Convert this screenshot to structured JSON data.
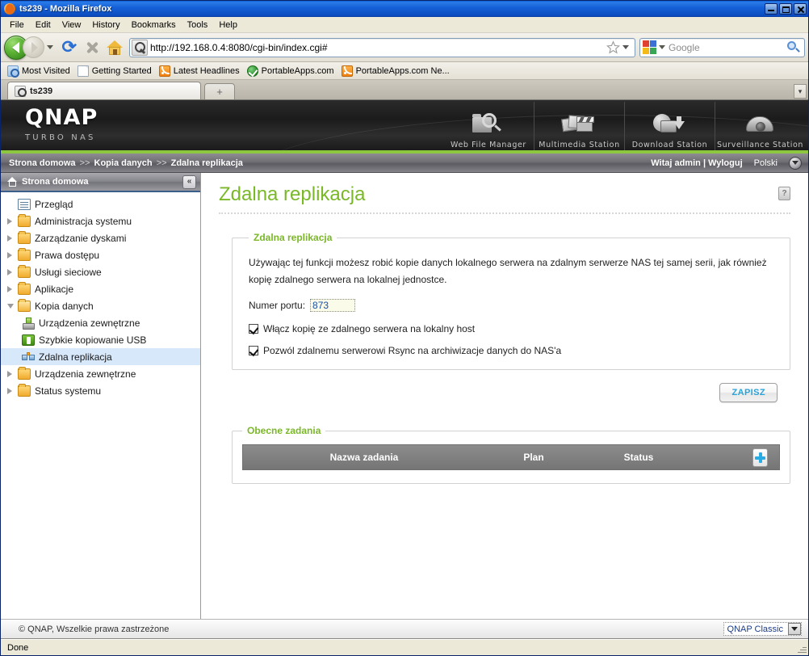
{
  "window": {
    "title": "ts239 - Mozilla Firefox",
    "favicon_icon": "firefox-icon",
    "minimize_label": "_",
    "maximize_label": "□",
    "close_label": "×"
  },
  "menubar": {
    "items": [
      {
        "label": "File"
      },
      {
        "label": "Edit"
      },
      {
        "label": "View"
      },
      {
        "label": "History"
      },
      {
        "label": "Bookmarks"
      },
      {
        "label": "Tools"
      },
      {
        "label": "Help"
      }
    ]
  },
  "toolbar": {
    "back_icon": "back-arrow-icon",
    "forward_icon": "forward-arrow-icon",
    "reload_glyph": "⟳",
    "stop_icon": "stop-icon",
    "home_icon": "home-icon",
    "url": "http://192.168.0.4:8080/cgi-bin/index.cgi#",
    "url_favicon": "qnap-site-icon",
    "bookmark_star_icon": "star-icon",
    "search_placeholder": "Google",
    "search_value": "",
    "search_engine_icon": "google-icon",
    "search_go_icon": "magnifier-icon"
  },
  "bookmarks": {
    "items": [
      {
        "label": "Most Visited",
        "icon": "folder-blue"
      },
      {
        "label": "Getting Started",
        "icon": "page"
      },
      {
        "label": "Latest Headlines",
        "icon": "rss"
      },
      {
        "label": "PortableApps.com",
        "icon": "pa"
      },
      {
        "label": "PortableApps.com Ne...",
        "icon": "rss"
      }
    ]
  },
  "tabs": {
    "active": {
      "label": "ts239",
      "icon": "qnap-tab-icon"
    },
    "new_tab_label": "+",
    "list_all_label": "▾"
  },
  "banner": {
    "brand": "QNAP",
    "tagline": "TURBO NAS",
    "stations": [
      {
        "label": "Web File Manager",
        "icon": "web-file-manager-icon"
      },
      {
        "label": "Multimedia Station",
        "icon": "multimedia-station-icon"
      },
      {
        "label": "Download Station",
        "icon": "download-station-icon"
      },
      {
        "label": "Surveillance Station",
        "icon": "surveillance-station-icon"
      }
    ]
  },
  "crumbbar": {
    "crumb1": "Strona domowa",
    "sep1": ">>",
    "crumb2": "Kopia danych",
    "sep2": ">>",
    "crumb3": "Zdalna replikacja",
    "greeting": "Witaj admin",
    "greet_sep": "|",
    "logout": "Wyloguj",
    "language": "Polski",
    "language_icon": "chevron-down-circle-icon"
  },
  "sidebar": {
    "header": "Strona domowa",
    "header_icon": "home-icon",
    "collapse_label": "«",
    "items": [
      {
        "label": "Przegląd",
        "icon": "list-icon",
        "level": 0,
        "twisty": "none",
        "selected": false
      },
      {
        "label": "Administracja systemu",
        "icon": "folder-icon",
        "level": 0,
        "twisty": "closed",
        "selected": false
      },
      {
        "label": "Zarządzanie dyskami",
        "icon": "folder-icon",
        "level": 0,
        "twisty": "closed",
        "selected": false
      },
      {
        "label": "Prawa dostępu",
        "icon": "folder-icon",
        "level": 0,
        "twisty": "closed",
        "selected": false
      },
      {
        "label": "Usługi sieciowe",
        "icon": "folder-icon",
        "level": 0,
        "twisty": "closed",
        "selected": false
      },
      {
        "label": "Aplikacje",
        "icon": "folder-icon",
        "level": 0,
        "twisty": "closed",
        "selected": false
      },
      {
        "label": "Kopia danych",
        "icon": "folder-open-icon",
        "level": 0,
        "twisty": "open",
        "selected": false
      },
      {
        "label": "Urządzenia zewnętrzne",
        "icon": "external-device-icon",
        "level": 1,
        "twisty": "none",
        "selected": false
      },
      {
        "label": "Szybkie kopiowanie USB",
        "icon": "usb-icon",
        "level": 1,
        "twisty": "none",
        "selected": false
      },
      {
        "label": "Zdalna replikacja",
        "icon": "replication-icon",
        "level": 1,
        "twisty": "none",
        "selected": true
      },
      {
        "label": "Urządzenia zewnętrzne",
        "icon": "folder-icon",
        "level": 0,
        "twisty": "closed",
        "selected": false
      },
      {
        "label": "Status systemu",
        "icon": "folder-icon",
        "level": 0,
        "twisty": "closed",
        "selected": false
      }
    ]
  },
  "main": {
    "page_title": "Zdalna replikacja",
    "help_label": "?",
    "panel": {
      "legend": "Zdalna replikacja",
      "description": "Używając tej funkcji możesz robić kopie danych lokalnego serwera na zdalnym serwerze NAS tej samej serii, jak również kopię zdalnego serwera na lokalnej jednostce.",
      "port_label": "Numer portu:",
      "port_value": "873",
      "checkbox1": "Włącz kopię ze zdalnego serwera na lokalny host",
      "checkbox1_checked": true,
      "checkbox2": "Pozwól zdalnemu serwerowi Rsync na archiwizacje danych do NAS'a",
      "checkbox2_checked": true
    },
    "save_label": "ZAPISZ",
    "tasks": {
      "legend": "Obecne zadania",
      "columns": [
        "Nazwa zadania",
        "Plan",
        "Status"
      ],
      "rows": [],
      "add_icon": "plus-icon"
    }
  },
  "page_footer": {
    "copyright": "© QNAP, Wszelkie prawa zastrzeżone",
    "theme_value": "QNAP Classic",
    "theme_caret_icon": "caret-down-icon"
  },
  "statusbar": {
    "text": "Done"
  },
  "colors": {
    "qnap_green": "#8dc63f",
    "title_green": "#7ab828",
    "accent_blue": "#29ace3",
    "selection_blue": "#d7e8fa"
  }
}
